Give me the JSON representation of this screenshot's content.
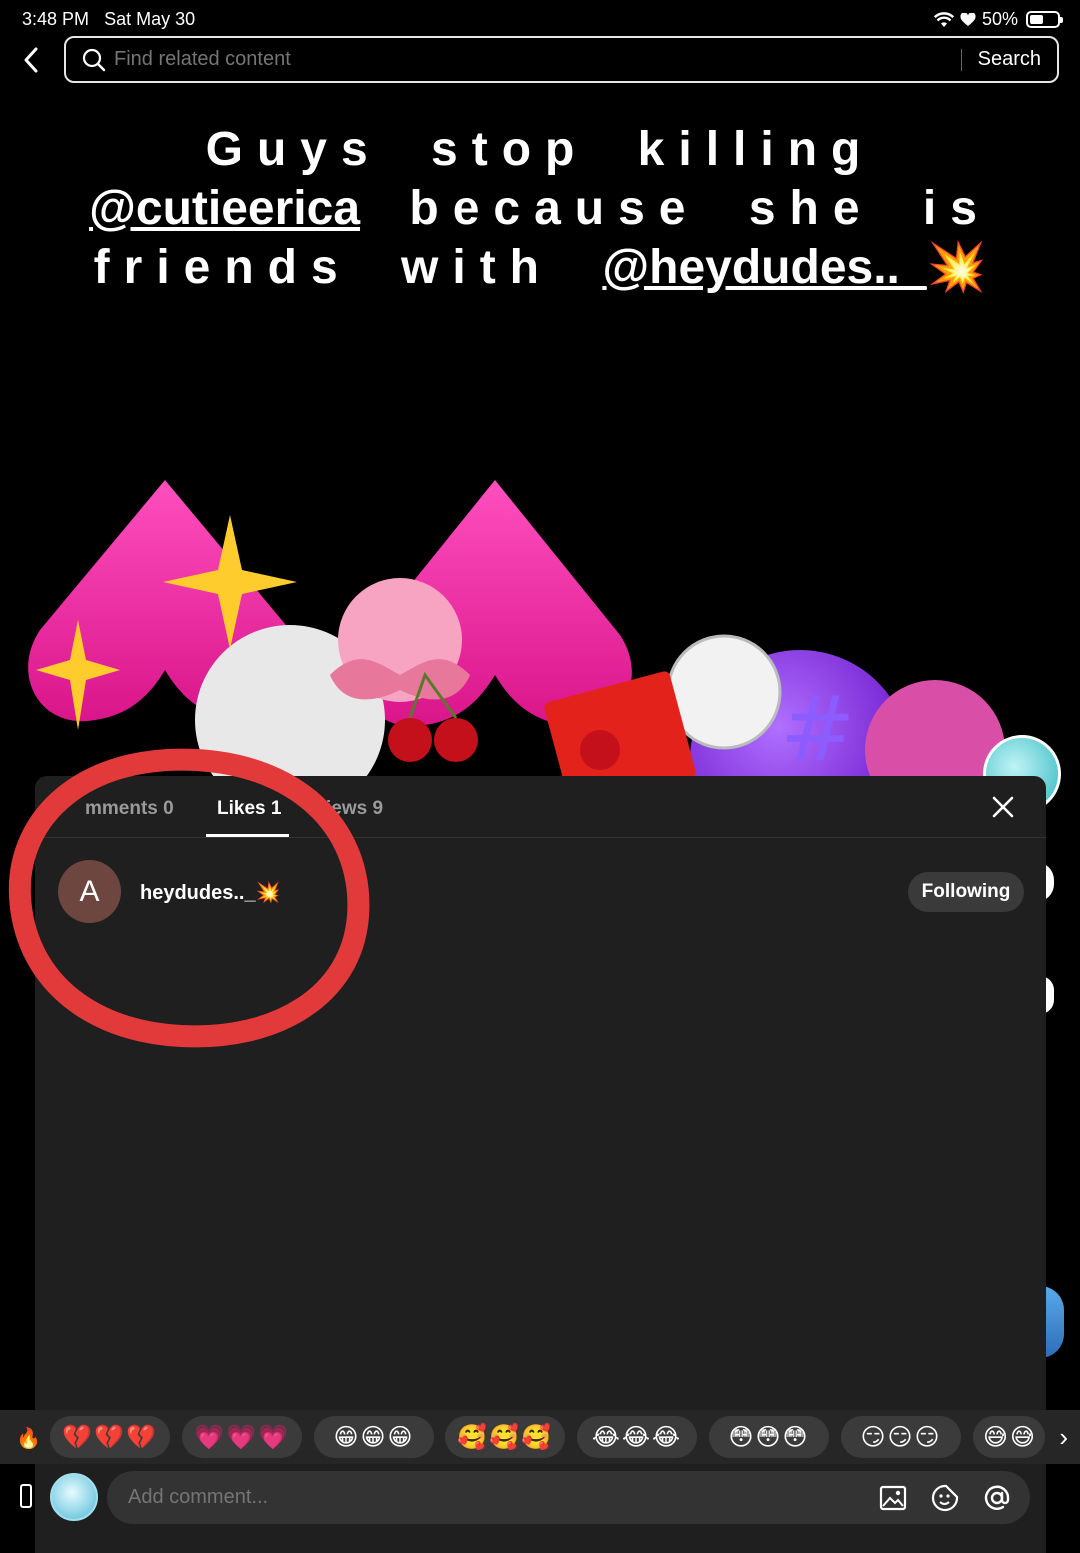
{
  "status_bar": {
    "time": "3:48 PM",
    "date": "Sat May 30",
    "battery": "50%"
  },
  "search": {
    "placeholder": "Find related content",
    "button": "Search"
  },
  "caption": {
    "line1": "Guys stop killing",
    "mention1": "@cutieerica",
    "line2": "because she is",
    "line3": "friends with",
    "mention2": "@heydudes.._",
    "spark": "💥"
  },
  "panel": {
    "tabs": [
      {
        "label": "mments 0",
        "active": false
      },
      {
        "label": "Likes 1",
        "active": true
      },
      {
        "label": "iews 9",
        "active": false
      }
    ],
    "likes": [
      {
        "avatar_letter": "A",
        "username": "heydudes.._💥",
        "button": "Following"
      }
    ]
  },
  "reactions": [
    "💔💔💔",
    "💗💗💗",
    "😁😁😁",
    "🥰🥰🥰",
    "😂😂😂",
    "😳😳😳",
    "😏😏😏",
    "😅😅"
  ],
  "composer": {
    "placeholder": "Add comment..."
  },
  "colors": {
    "panel": "#1f1f1f",
    "annotation": "#e23a3a",
    "avatar": "#6e4640",
    "pink": "#ff3ea8"
  }
}
